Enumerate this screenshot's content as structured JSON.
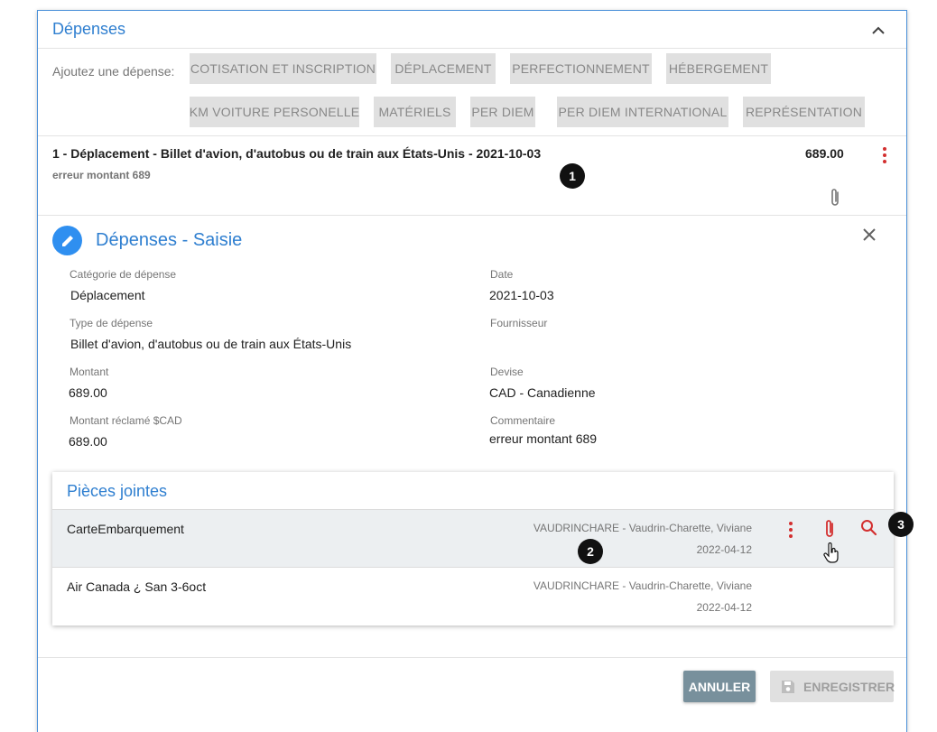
{
  "panel": {
    "title": "Dépenses"
  },
  "add_expense": {
    "label": "Ajoutez une dépense:",
    "chips": [
      "COTISATION ET INSCRIPTION",
      "DÉPLACEMENT",
      "PERFECTIONNEMENT",
      "HÉBERGEMENT",
      "KM VOITURE PERSONELLE",
      "MATÉRIELS",
      "PER DIEM",
      "PER DIEM INTERNATIONAL",
      "REPRÉSENTATION"
    ]
  },
  "expense_item": {
    "title": "1 - Déplacement - Billet d'avion, d'autobus ou de train aux États-Unis - 2021-10-03",
    "amount": "689.00",
    "comment": "erreur montant 689"
  },
  "markers": [
    "1",
    "2",
    "3"
  ],
  "form": {
    "title": "Dépenses - Saisie",
    "fields": {
      "category": {
        "label": "Catégorie de dépense",
        "value": "Déplacement"
      },
      "date": {
        "label": "Date",
        "value": "2021-10-03"
      },
      "type": {
        "label": "Type de dépense",
        "value": "Billet d'avion, d'autobus ou de train aux États-Unis"
      },
      "supplier": {
        "label": "Fournisseur",
        "value": ""
      },
      "amount": {
        "label": "Montant",
        "value": "689.00"
      },
      "currency": {
        "label": "Devise",
        "value": "CAD - Canadienne"
      },
      "claimed": {
        "label": "Montant réclamé $CAD",
        "value": "689.00"
      },
      "comment": {
        "label": "Commentaire",
        "value": "erreur montant 689"
      }
    }
  },
  "attachments": {
    "title": "Pièces jointes",
    "rows": [
      {
        "name": "CarteEmbarquement",
        "owner": "VAUDRINCHARE - Vaudrin-Charette, Viviane",
        "date": "2022-04-12"
      },
      {
        "name": "Air Canada ¿ San 3-6oct",
        "owner": "VAUDRINCHARE - Vaudrin-Charette, Viviane",
        "date": "2022-04-12"
      }
    ]
  },
  "footer": {
    "cancel_label": "ANNULER",
    "save_label": "ENREGISTRER"
  },
  "colors": {
    "accent": "#2f7fd0",
    "danger": "#d32f2f",
    "chip_bg": "#e0e0e0",
    "cancel_bg": "#78909c"
  },
  "icons": [
    "chevron-up-icon",
    "kebab-menu-icon",
    "paperclip-icon",
    "pencil-icon",
    "close-icon",
    "search-icon",
    "save-icon",
    "hand-pointer-icon"
  ]
}
